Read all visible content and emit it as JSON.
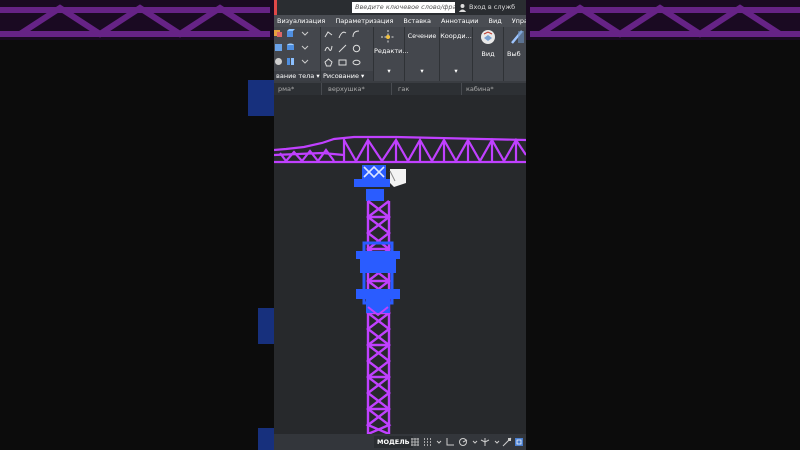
{
  "window": {
    "search_placeholder": "Введите ключевое слово/фразу",
    "sign_in_label": "Вход в служб"
  },
  "menu": {
    "tabs": [
      "Визуализация",
      "Параметризация",
      "Вставка",
      "Аннотации",
      "Вид",
      "Управлен"
    ]
  },
  "ribbon": {
    "panel_modeling_label": "вание тела",
    "panel_drawing_label": "Рисование",
    "edit_label": "Редакти...",
    "section_label": "Сечение",
    "coordinates_label": "Коорди...",
    "view_label": "Вид",
    "select_label": "Выб"
  },
  "drawing_tabs": [
    "рма*",
    "верхушка*",
    "гак",
    "кабина*"
  ],
  "statusbar": {
    "model_label": "МОДЕЛЬ"
  },
  "colors": {
    "crane_lattice": "#c040ff",
    "crane_blue_parts": "#2a5cff",
    "viewport_bg": "#27292c"
  }
}
